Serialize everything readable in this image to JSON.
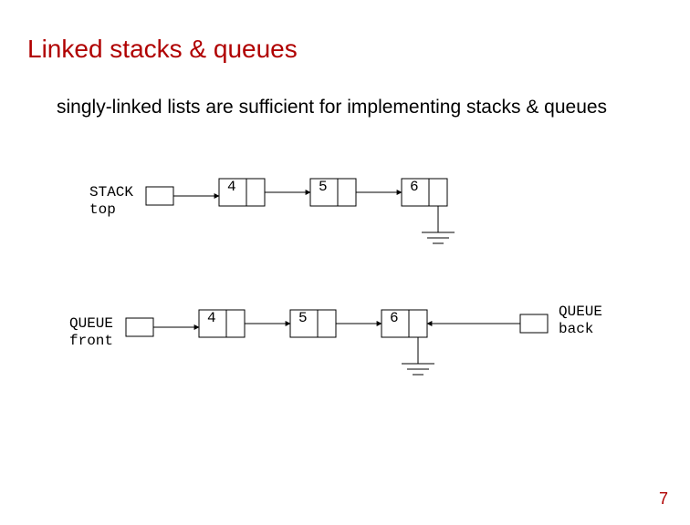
{
  "title": "Linked stacks & queues",
  "body": "singly-linked lists are sufficient for implementing stacks & queues",
  "page": "7",
  "labels": {
    "stack": "STACK\ntop",
    "queueFront": "QUEUE\nfront",
    "queueBack": "QUEUE\nback"
  },
  "stack": {
    "n1": "4",
    "n2": "5",
    "n3": "6"
  },
  "queue": {
    "n1": "4",
    "n2": "5",
    "n3": "6"
  }
}
